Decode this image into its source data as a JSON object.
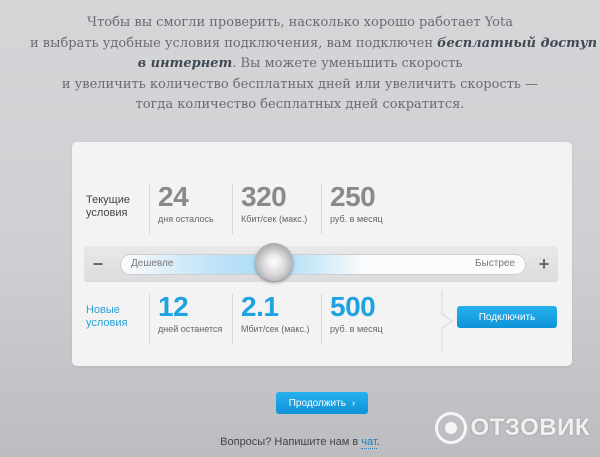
{
  "intro": {
    "line1": "Чтобы вы смогли проверить, насколько хорошо работает Yota",
    "line2_pre": "и выбрать удобные условия подключения, вам подключен ",
    "line2_bold": "бесплатный доступ",
    "line3_bold": "в интернет",
    "line3_post": ". Вы можете уменьшить скорость",
    "line4": "и увеличить количество бесплатных дней или увеличить скорость —",
    "line5": "тогда количество бесплатных дней сократится."
  },
  "current": {
    "label_line1": "Текущие",
    "label_line2": "условия",
    "days": "24",
    "days_unit": "дня осталось",
    "speed": "320",
    "speed_unit": "Кбит/сек (макс.)",
    "price": "250",
    "price_unit": "руб. в месяц"
  },
  "slider": {
    "minus": "−",
    "plus": "+",
    "left_label": "Дешевле",
    "right_label": "Быстрее",
    "position": 0.38
  },
  "new": {
    "label_line1": "Новые",
    "label_line2": "условия",
    "days": "12",
    "days_unit": "дней останется",
    "speed": "2.1",
    "speed_unit": "Мбит/сек (макс.)",
    "price": "500",
    "price_unit": "руб. в месяц",
    "connect_label": "Подключить"
  },
  "continue_label": "Продолжить",
  "continue_arrow": "›",
  "footer": {
    "text": "Вопросы? Напишите нам в ",
    "link": "чат",
    "end": "."
  },
  "watermark": "ОТЗОВИК",
  "colors": {
    "accent": "#1fa3e0",
    "button": "#1a9ee0"
  }
}
